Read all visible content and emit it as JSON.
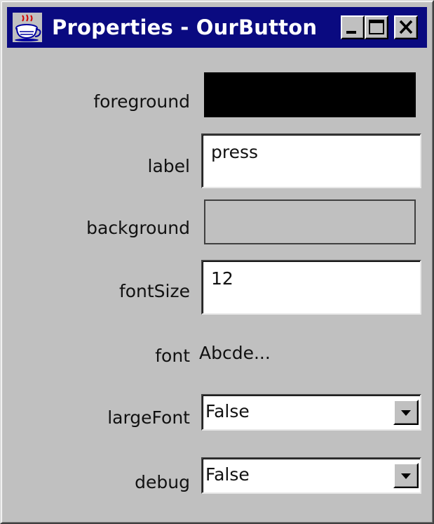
{
  "window": {
    "title": "Properties - OurButton",
    "icon": "java-coffee-cup-icon",
    "controls": [
      "minimize-icon",
      "maximize-icon",
      "close-icon"
    ]
  },
  "properties": {
    "foreground": {
      "label": "foreground",
      "color": "#000000"
    },
    "label": {
      "label": "label",
      "value": "press"
    },
    "background": {
      "label": "background",
      "color": "#c0c0c0"
    },
    "fontSize": {
      "label": "fontSize",
      "value": "12"
    },
    "font": {
      "label": "font",
      "preview": "Abcde..."
    },
    "largeFont": {
      "label": "largeFont",
      "selected": "False"
    },
    "debug": {
      "label": "debug",
      "selected": "False"
    }
  },
  "colors": {
    "titlebar": "#0a0a80",
    "window_bg": "#c0c0c0"
  }
}
